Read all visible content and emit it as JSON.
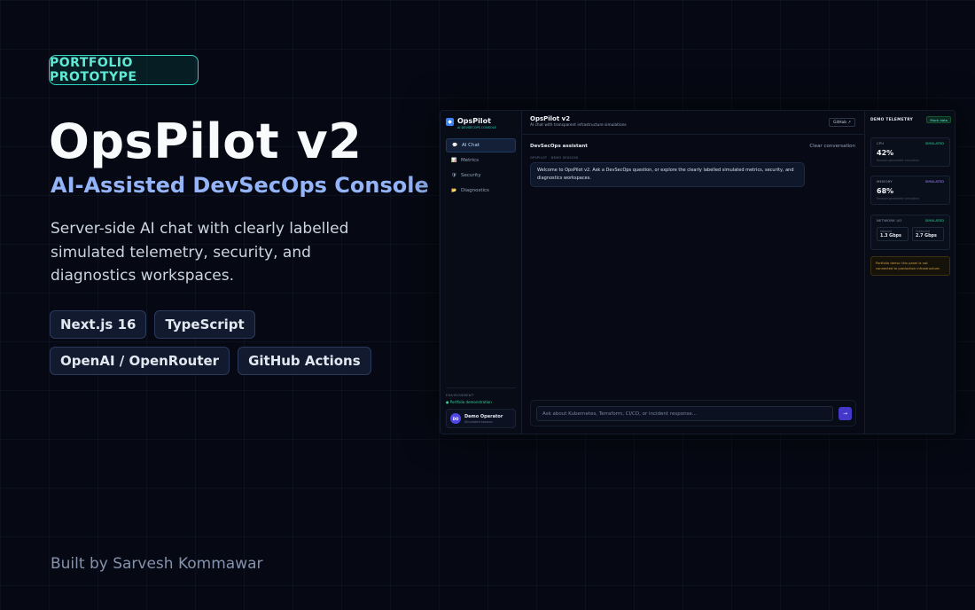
{
  "hero": {
    "badge": "PORTFOLIO PROTOTYPE",
    "title": "OpsPilot v2",
    "subtitle": "AI-Assisted DevSecOps Console",
    "description": "Server-side AI chat with clearly labelled simulated telemetry, security, and diagnostics workspaces.",
    "tags": [
      "Next.js 16",
      "TypeScript",
      "OpenAI / OpenRouter",
      "GitHub Actions"
    ],
    "credit": "Built by Sarvesh Kommawar"
  },
  "app": {
    "brand": {
      "name": "OpsPilot",
      "sub": "AI DEVSECOPS CONSOLE"
    },
    "nav": [
      {
        "icon": "chat-icon",
        "glyph": "💬",
        "label": "AI Chat"
      },
      {
        "icon": "chart-icon",
        "glyph": "📊",
        "label": "Metrics"
      },
      {
        "icon": "shield-icon",
        "glyph": "🛡",
        "label": "Security"
      },
      {
        "icon": "folder-icon",
        "glyph": "📂",
        "label": "Diagnostics"
      }
    ],
    "environment": {
      "label": "ENVIRONMENT",
      "value": "● Portfolio demonstration"
    },
    "user": {
      "initials": "DO",
      "name": "Demo Operator",
      "role": "Simulated session"
    },
    "header": {
      "title": "OpsPilot v2",
      "subtitle": "AI chat with transparent infrastructure simulations",
      "github": "GitHub ↗"
    },
    "chat": {
      "title": "DevSecOps assistant",
      "clear": "Clear conversation",
      "meta": "OPSPILOT  ·  DEMO SESSION",
      "message": "Welcome to OpsPilot v2. Ask a DevSecOps question, or explore the clearly labelled simulated metrics, security, and diagnostics workspaces.",
      "placeholder": "Ask about Kubernetes, Terraform, CI/CD, or incident response...",
      "send": "→"
    },
    "telemetry": {
      "title": "DEMO TELEMETRY",
      "badge": "Mock data",
      "cpu": {
        "label": "CPU",
        "tag": "SIMULATED",
        "value": "42%",
        "note": "Browser-generated simulation"
      },
      "memory": {
        "label": "MEMORY",
        "tag": "SIMULATED",
        "value": "68%",
        "note": "Browser-generated simulation"
      },
      "network": {
        "label": "NETWORK I/O",
        "tag": "SIMULATED",
        "in_label": "Inbound",
        "in_value": "1.3 Gbps",
        "out_label": "Outbound",
        "out_value": "2.7 Gbps"
      },
      "warning": "Portfolio demo: this panel is not connected to production infrastructure."
    }
  },
  "colors": {
    "accent": "#2dd4bf",
    "subtitle": "#93b4f8",
    "simulated_green": "#34d399",
    "simulated_purple": "#a78bfa"
  }
}
